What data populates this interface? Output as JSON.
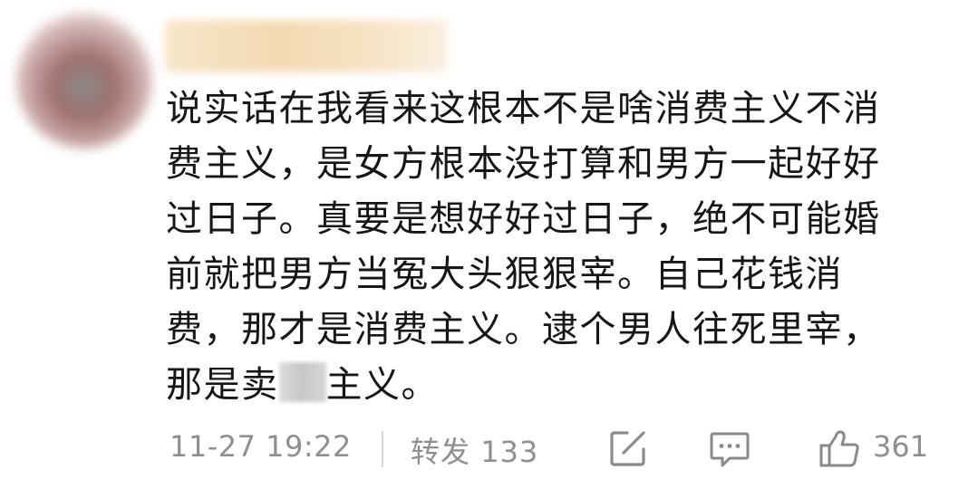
{
  "comment": {
    "avatar_icon": "avatar-blurred",
    "username": "",
    "lines": [
      "说实话在我看来这根本不是啥消费主义不消",
      "费主义，是女方根本没打算和男方一起好好",
      "过日子。真要是想好好过日子，绝不可能婚",
      "前就把男方当冤大头狠狠宰。自己花钱消",
      "费，那才是消费主义。逮个男人往死里宰，"
    ],
    "last_line_before": "那是卖",
    "last_line_after": "主义。",
    "timestamp": "11-27 19:22",
    "repost_label": "转发",
    "repost_count": "133",
    "like_count": "361",
    "icons": {
      "edit": "edit-icon",
      "comment": "comment-icon",
      "like": "thumbs-up-icon"
    },
    "colors": {
      "text": "#161616",
      "meta": "#8f8f8f"
    }
  }
}
